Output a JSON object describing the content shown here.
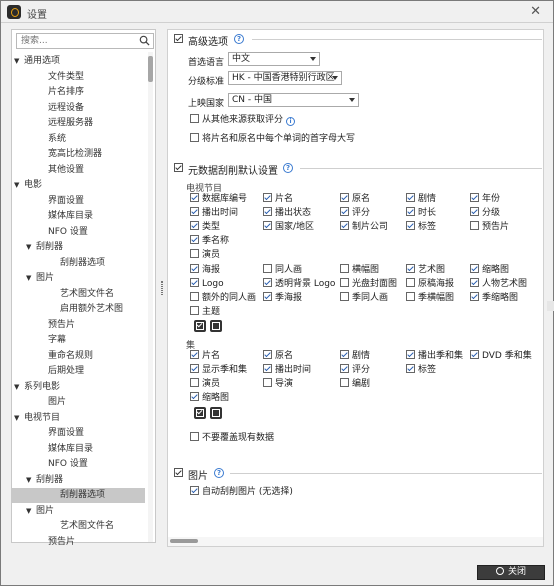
{
  "window": {
    "title": "设置",
    "close_glyph": "✕"
  },
  "search": {
    "placeholder": "搜索..."
  },
  "tree": [
    {
      "label": "通用选项",
      "level": 0,
      "expanded": true
    },
    {
      "label": "文件类型",
      "level": 2
    },
    {
      "label": "片名排序",
      "level": 2
    },
    {
      "label": "远程设备",
      "level": 2
    },
    {
      "label": "远程服务器",
      "level": 2
    },
    {
      "label": "系统",
      "level": 2
    },
    {
      "label": "宽高比检测器",
      "level": 2
    },
    {
      "label": "其他设置",
      "level": 2
    },
    {
      "label": "电影",
      "level": 0,
      "expanded": true
    },
    {
      "label": "界面设置",
      "level": 2
    },
    {
      "label": "媒体库目录",
      "level": 2
    },
    {
      "label": "NFO 设置",
      "level": 2
    },
    {
      "label": "刮削器",
      "level": 1,
      "expanded": true
    },
    {
      "label": "刮削器选项",
      "level": 3
    },
    {
      "label": "图片",
      "level": 1,
      "expanded": true
    },
    {
      "label": "艺术图文件名",
      "level": 3
    },
    {
      "label": "启用额外艺术图",
      "level": 3
    },
    {
      "label": "预告片",
      "level": 2
    },
    {
      "label": "字幕",
      "level": 2
    },
    {
      "label": "重命名规则",
      "level": 2
    },
    {
      "label": "后期处理",
      "level": 2
    },
    {
      "label": "系列电影",
      "level": 0,
      "expanded": true
    },
    {
      "label": "图片",
      "level": 2
    },
    {
      "label": "电视节目",
      "level": 0,
      "expanded": true
    },
    {
      "label": "界面设置",
      "level": 2
    },
    {
      "label": "媒体库目录",
      "level": 2
    },
    {
      "label": "NFO 设置",
      "level": 2
    },
    {
      "label": "刮削器",
      "level": 1,
      "expanded": true
    },
    {
      "label": "刮削器选项",
      "level": 3,
      "selected": true
    },
    {
      "label": "图片",
      "level": 1,
      "expanded": true
    },
    {
      "label": "艺术图文件名",
      "level": 3
    },
    {
      "label": "预告片",
      "level": 2
    }
  ],
  "advanced": {
    "title": "高级选项",
    "help": "?",
    "language_label": "首选语言",
    "language_value": "中文",
    "cert_label": "分级标准",
    "cert_value": "HK - 中国香港特别行政区",
    "country_label": "上映国家",
    "country_value": "CN - 中国",
    "other_rating_label": "从其他来源获取评分",
    "other_rating_info": "i",
    "capitalize_label": "将片名和原名中每个单词的首字母大写"
  },
  "metadata": {
    "title": "元数据刮削默认设置",
    "help": "?",
    "tv_label": "电视节目",
    "tv_rows": [
      [
        {
          "t": "数据库编号",
          "c": true
        },
        {
          "t": "片名",
          "c": true
        },
        {
          "t": "原名",
          "c": true
        },
        {
          "t": "剧情",
          "c": true
        },
        {
          "t": "年份",
          "c": true
        }
      ],
      [
        {
          "t": "播出时间",
          "c": true
        },
        {
          "t": "播出状态",
          "c": true
        },
        {
          "t": "评分",
          "c": true
        },
        {
          "t": "时长",
          "c": true
        },
        {
          "t": "分级",
          "c": true
        }
      ],
      [
        {
          "t": "类型",
          "c": true
        },
        {
          "t": "国家/地区",
          "c": true
        },
        {
          "t": "制片公司",
          "c": true
        },
        {
          "t": "标签",
          "c": true
        },
        {
          "t": "预告片",
          "c": false
        }
      ],
      [
        {
          "t": "季名称",
          "c": true
        }
      ],
      [
        {
          "t": "演员",
          "c": false
        }
      ],
      [
        {
          "t": "海报",
          "c": true
        },
        {
          "t": "同人画",
          "c": false
        },
        {
          "t": "横幅图",
          "c": false
        },
        {
          "t": "艺术图",
          "c": true
        },
        {
          "t": "缩略图",
          "c": true
        }
      ],
      [
        {
          "t": "Logo",
          "c": true
        },
        {
          "t": "透明背景 Logo",
          "c": true
        },
        {
          "t": "光盘封面图",
          "c": false
        },
        {
          "t": "原稿海报",
          "c": false
        },
        {
          "t": "人物艺术图",
          "c": true
        }
      ],
      [
        {
          "t": "额外的同人画",
          "c": false
        },
        {
          "t": "季海报",
          "c": true
        },
        {
          "t": "季同人画",
          "c": false
        },
        {
          "t": "季横幅图",
          "c": false
        },
        {
          "t": "季缩略图",
          "c": true
        }
      ],
      [
        {
          "t": "主题",
          "c": false
        }
      ]
    ],
    "ep_label": "集",
    "ep_rows": [
      [
        {
          "t": "片名",
          "c": true
        },
        {
          "t": "原名",
          "c": true
        },
        {
          "t": "剧情",
          "c": true
        },
        {
          "t": "播出季和集",
          "c": true
        },
        {
          "t": "DVD 季和集",
          "c": true
        }
      ],
      [
        {
          "t": "显示季和集",
          "c": true
        },
        {
          "t": "播出时间",
          "c": true
        },
        {
          "t": "评分",
          "c": true
        },
        {
          "t": "标签",
          "c": true
        }
      ],
      [
        {
          "t": "演员",
          "c": false
        },
        {
          "t": "导演",
          "c": false
        },
        {
          "t": "编剧",
          "c": false
        }
      ],
      [
        {
          "t": "缩略图",
          "c": true
        }
      ]
    ],
    "no_overwrite_label": "不要覆盖现有数据"
  },
  "images": {
    "title": "图片",
    "help": "?",
    "auto_label": "自动刮削图片 (无选择)"
  },
  "footer": {
    "close_label": "关闭"
  }
}
